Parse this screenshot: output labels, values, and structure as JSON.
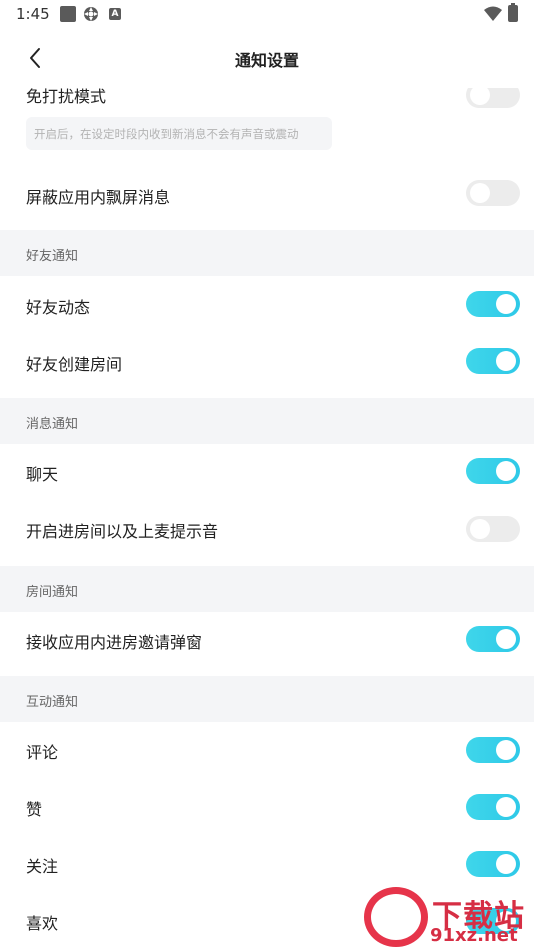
{
  "status_bar": {
    "time": "1:45",
    "icons": [
      "square-icon",
      "gear-icon",
      "a-icon",
      "wifi-icon",
      "battery-icon"
    ]
  },
  "header": {
    "title": "通知设置",
    "back_icon": "chevron-left-icon"
  },
  "settings": {
    "dnd": {
      "label": "免打扰模式",
      "enabled": false,
      "hint": "开启后，在设定时段内收到新消息不会有声音或震动"
    },
    "block_popup": {
      "label": "屏蔽应用内飘屏消息",
      "enabled": false
    }
  },
  "sections": {
    "friends": {
      "title": "好友通知",
      "items": [
        {
          "label": "好友动态",
          "enabled": true
        },
        {
          "label": "好友创建房间",
          "enabled": true
        }
      ]
    },
    "messages": {
      "title": "消息通知",
      "items": [
        {
          "label": "聊天",
          "enabled": true
        },
        {
          "label": "开启进房间以及上麦提示音",
          "enabled": false
        }
      ]
    },
    "room": {
      "title": "房间通知",
      "items": [
        {
          "label": "接收应用内进房邀请弹窗",
          "enabled": true
        }
      ]
    },
    "interaction": {
      "title": "互动通知",
      "items": [
        {
          "label": "评论",
          "enabled": true
        },
        {
          "label": "赞",
          "enabled": true
        },
        {
          "label": "关注",
          "enabled": true
        },
        {
          "label": "喜欢",
          "enabled": true
        }
      ]
    }
  },
  "watermark": {
    "text": "下载站",
    "url": "91xz.net"
  },
  "colors": {
    "toggle_on": "#2ec9e8",
    "toggle_off": "#ececec",
    "section_bg": "#f4f5f7"
  }
}
